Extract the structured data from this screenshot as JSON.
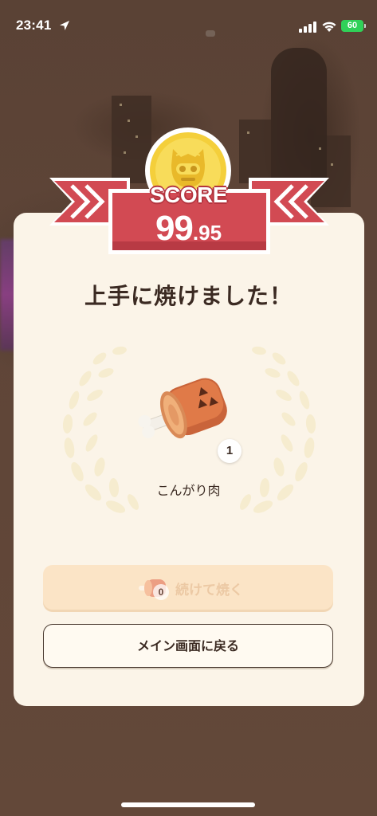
{
  "status_bar": {
    "time": "23:41",
    "battery_level": "60",
    "location_icon": "location-arrow-icon",
    "signal_icon": "cellular-signal-icon",
    "wifi_icon": "wifi-icon",
    "battery_color": "#30d158"
  },
  "result": {
    "score_label": "SCORE",
    "score_integer": "99",
    "score_decimal": ".95",
    "title": "上手に焼けました！",
    "medal_icon": "cat-medal-icon",
    "banner_color": "#d24a53"
  },
  "item": {
    "icon": "roasted-meat-icon",
    "name": "こんがり肉",
    "count": "1"
  },
  "actions": {
    "continue_label": "続けて焼く",
    "continue_count": "0",
    "continue_enabled": false,
    "main_menu_label": "メイン画面に戻る"
  }
}
